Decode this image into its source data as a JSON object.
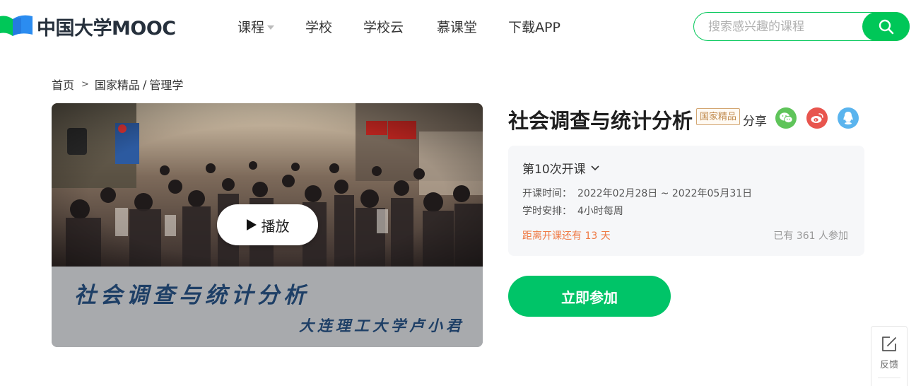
{
  "header": {
    "logo_text": "中国大学MOOC",
    "nav": [
      {
        "label": "课程",
        "has_dropdown": true
      },
      {
        "label": "学校"
      },
      {
        "label": "学校云"
      },
      {
        "label": "慕课堂"
      },
      {
        "label": "下载APP"
      }
    ],
    "search": {
      "placeholder": "搜索感兴趣的课程",
      "value": ""
    }
  },
  "breadcrumb": {
    "home": "首页",
    "separator": ">",
    "category": "国家精品",
    "slash": "/",
    "subcategory": "管理学"
  },
  "cover": {
    "title": "社会调查与统计分析",
    "author": "大连理工大学卢小君",
    "play_label": "播放"
  },
  "course": {
    "title": "社会调查与统计分析",
    "badge": "国家精品",
    "share_label": "分享",
    "share_icons": [
      "wechat-icon",
      "weibo-icon",
      "qq-icon"
    ],
    "session": "第10次开课",
    "schedule_label": "开课时间：",
    "schedule_value": "2022年02月28日 ~ 2022年05月31日",
    "workload_label": "学时安排：",
    "workload_value": "4小时每周",
    "countdown": "距离开课还有 13 天",
    "enrolled": "已有 361 人参加",
    "join_label": "立即参加"
  },
  "feedback": {
    "label": "反馈"
  },
  "colors": {
    "brand_green": "#00c758",
    "countdown_orange": "#ef7a45",
    "badge_gold": "#c08a4c",
    "wechat": "#5fc45a",
    "weibo": "#e8554e",
    "qq": "#5ab4ee"
  }
}
